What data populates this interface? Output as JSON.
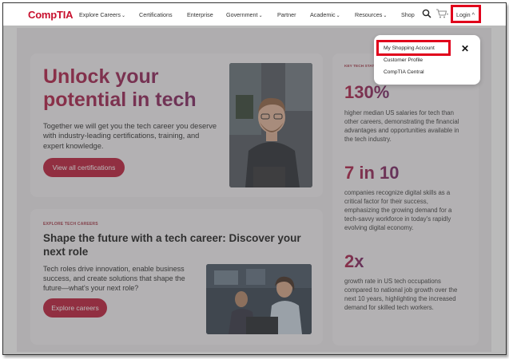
{
  "header": {
    "logo": "CompTIA",
    "nav": [
      {
        "label": "Explore Careers",
        "chevron": true
      },
      {
        "label": "Certifications",
        "chevron": false
      },
      {
        "label": "Enterprise",
        "chevron": false
      },
      {
        "label": "Government",
        "chevron": true
      },
      {
        "label": "Partner",
        "chevron": false
      },
      {
        "label": "Academic",
        "chevron": true
      },
      {
        "label": "Resources",
        "chevron": true
      },
      {
        "label": "Shop",
        "chevron": false
      }
    ],
    "login_label": "Login",
    "chevron_glyph": "⌄",
    "login_chevron": "^",
    "accent_color": "#c8102e"
  },
  "dropdown": {
    "items": [
      "My Shopping Account",
      "Customer Profile",
      "CompTIA Central"
    ],
    "close_glyph": "✕"
  },
  "hero": {
    "title": "Unlock your potential in tech",
    "description": "Together we will get you the tech career you deserve with industry-leading certifications, training, and expert knowledge.",
    "button": "View all certifications"
  },
  "explore": {
    "eyebrow": "EXPLORE TECH CAREERS",
    "title": "Shape the future with a tech career: Discover your next role",
    "description": "Tech roles drive innovation, enable business success, and create solutions that shape the future—what's your next role?",
    "button": "Explore careers"
  },
  "stats": {
    "eyebrow": "KEY TECH STATS",
    "items": [
      {
        "value": "130%",
        "text": "higher median US salaries for tech than other careers, demonstrating the financial advantages and opportunities available in the tech industry."
      },
      {
        "value": "7 in 10",
        "text": "companies recognize digital skills as a critical factor for their success, emphasizing the growing demand for a tech-savvy workforce in today's rapidly evolving digital economy."
      },
      {
        "value": "2x",
        "text": "growth rate in US tech occupations compared to national job growth over the next 10 years, highlighting the increased demand for skilled tech workers."
      }
    ]
  }
}
